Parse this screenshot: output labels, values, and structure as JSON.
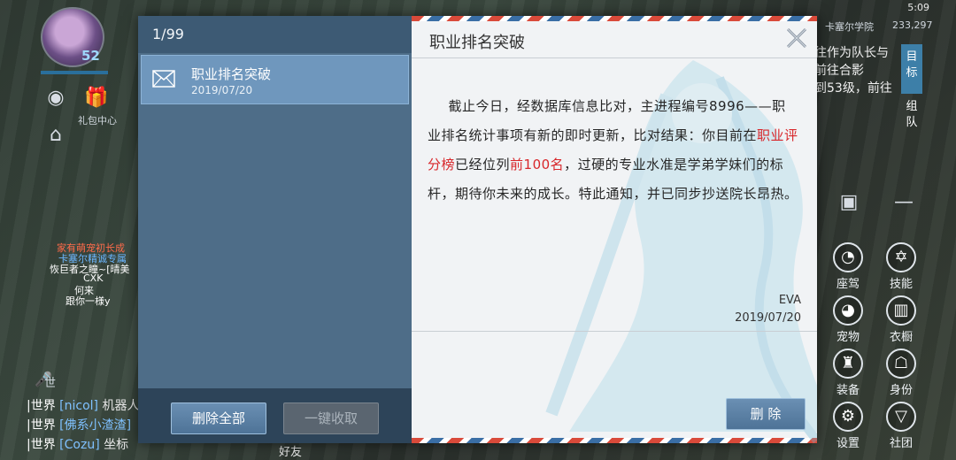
{
  "hud": {
    "level": "52",
    "gift_center": "礼包中心",
    "status_time": "5:09",
    "status_location": "卡塞尔学院",
    "status_coords": "233,297",
    "float_texts": [
      "家有萌宠初长成",
      "卡塞尔精诚专属",
      "恢巨者之瞳~[晴美",
      "CXK",
      "何来",
      "跟你一様y"
    ],
    "chat": [
      {
        "channel": "|世界",
        "name": "[nicol]",
        "text": "机器人"
      },
      {
        "channel": "|世界",
        "name": "[佛系小渣渣]",
        "text": ""
      },
      {
        "channel": "|世界",
        "name": "[Cozu]",
        "text": "坐标"
      }
    ],
    "chat_toggle": "世",
    "quest_text": "往作为队长与\n前往合影\n到53级，前往",
    "quest_tabs": [
      "目标",
      "组队"
    ],
    "menu": [
      "座驾",
      "技能",
      "宠物",
      "衣橱",
      "装备",
      "身份",
      "设置",
      "社团"
    ],
    "bottom_label": "好友"
  },
  "mail_list": {
    "counter": "1/99",
    "items": [
      {
        "title": "职业排名突破",
        "date": "2019/07/20"
      }
    ],
    "delete_all_label": "删除全部",
    "collect_all_label": "一键收取"
  },
  "mail_content": {
    "title": "职业排名突破",
    "body_part1": "截止今日，经数据库信息比对，主进程编号8996——职业排名统计事项有新的即时更新，比对结果：你目前在",
    "body_hl1": "职业评分榜",
    "body_part2": "已经位列",
    "body_hl2": "前100名",
    "body_part3": "，过硬的专业水准是学弟学妹们的标杆，期待你未来的成长。特此通知，并已同步抄送院长昂热。",
    "sender": "EVA",
    "date": "2019/07/20",
    "delete_label": "删 除"
  },
  "colors": {
    "highlight": "#d8262a",
    "list_bg": "#4e6d88",
    "selected_item": "#6f97bd",
    "content_bg": "#f1f3f5"
  }
}
